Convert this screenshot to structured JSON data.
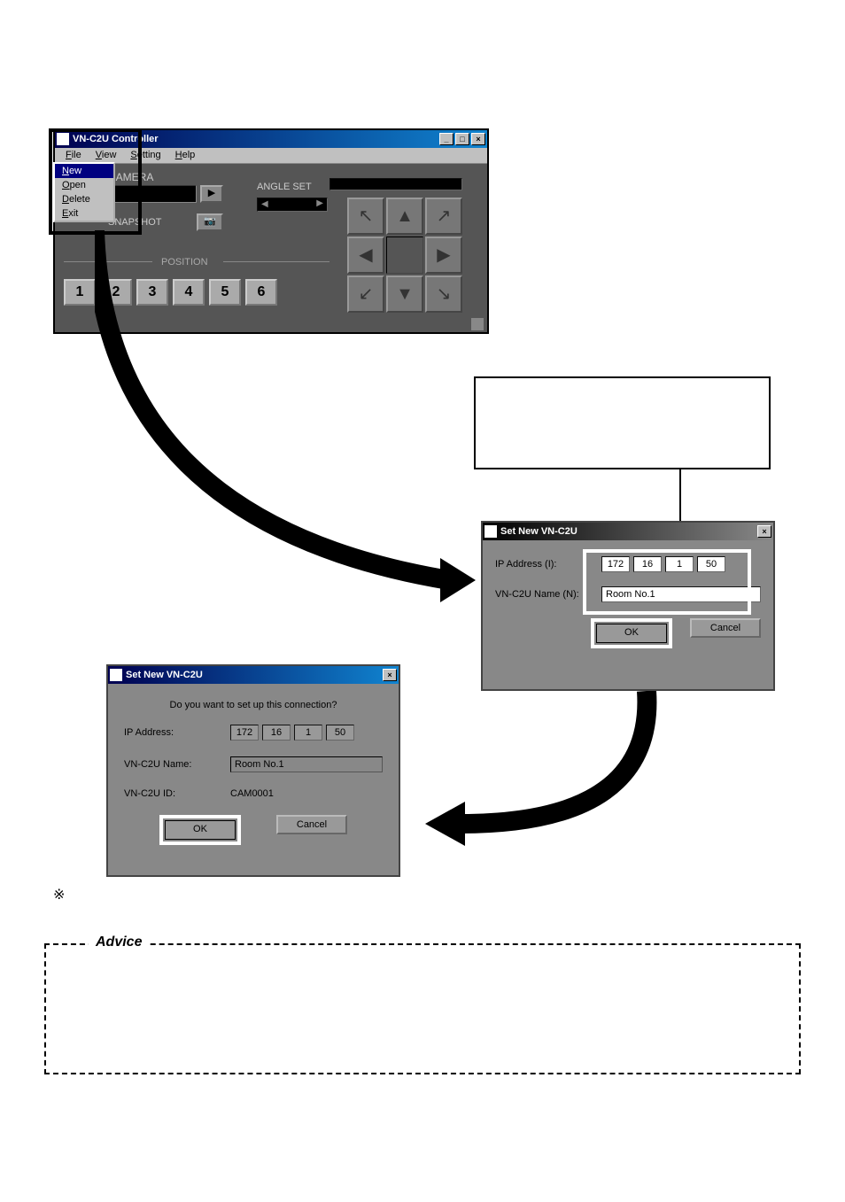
{
  "controller": {
    "title": "VN-C2U Controller",
    "menu": {
      "file": "File",
      "view": "View",
      "setting": "Setting",
      "help": "Help"
    },
    "dropdown": {
      "new": "New",
      "open": "Open",
      "delete": "Delete",
      "exit": "Exit"
    },
    "camera_label": "CAMERA",
    "snapshot_label": "SNAPSHOT",
    "angle_label": "ANGLE SET",
    "position_label": "POSITION",
    "positions": [
      "1",
      "2",
      "3",
      "4",
      "5",
      "6"
    ]
  },
  "dialog1": {
    "title": "Set New VN-C2U",
    "ip_label": "IP Address (I):",
    "name_label": "VN-C2U Name (N):",
    "ip": [
      "172",
      "16",
      "1",
      "50"
    ],
    "name_value": "Room No.1",
    "ok": "OK",
    "cancel": "Cancel"
  },
  "dialog2": {
    "title": "Set New VN-C2U",
    "prompt": "Do you want to set up this connection?",
    "ip_label": "IP Address:",
    "name_label": "VN-C2U Name:",
    "id_label": "VN-C2U ID:",
    "ip": [
      "172",
      "16",
      "1",
      "50"
    ],
    "name_value": "Room No.1",
    "id_value": "CAM0001",
    "ok": "OK",
    "cancel": "Cancel"
  },
  "advice_label": "Advice",
  "ref_mark": "※"
}
